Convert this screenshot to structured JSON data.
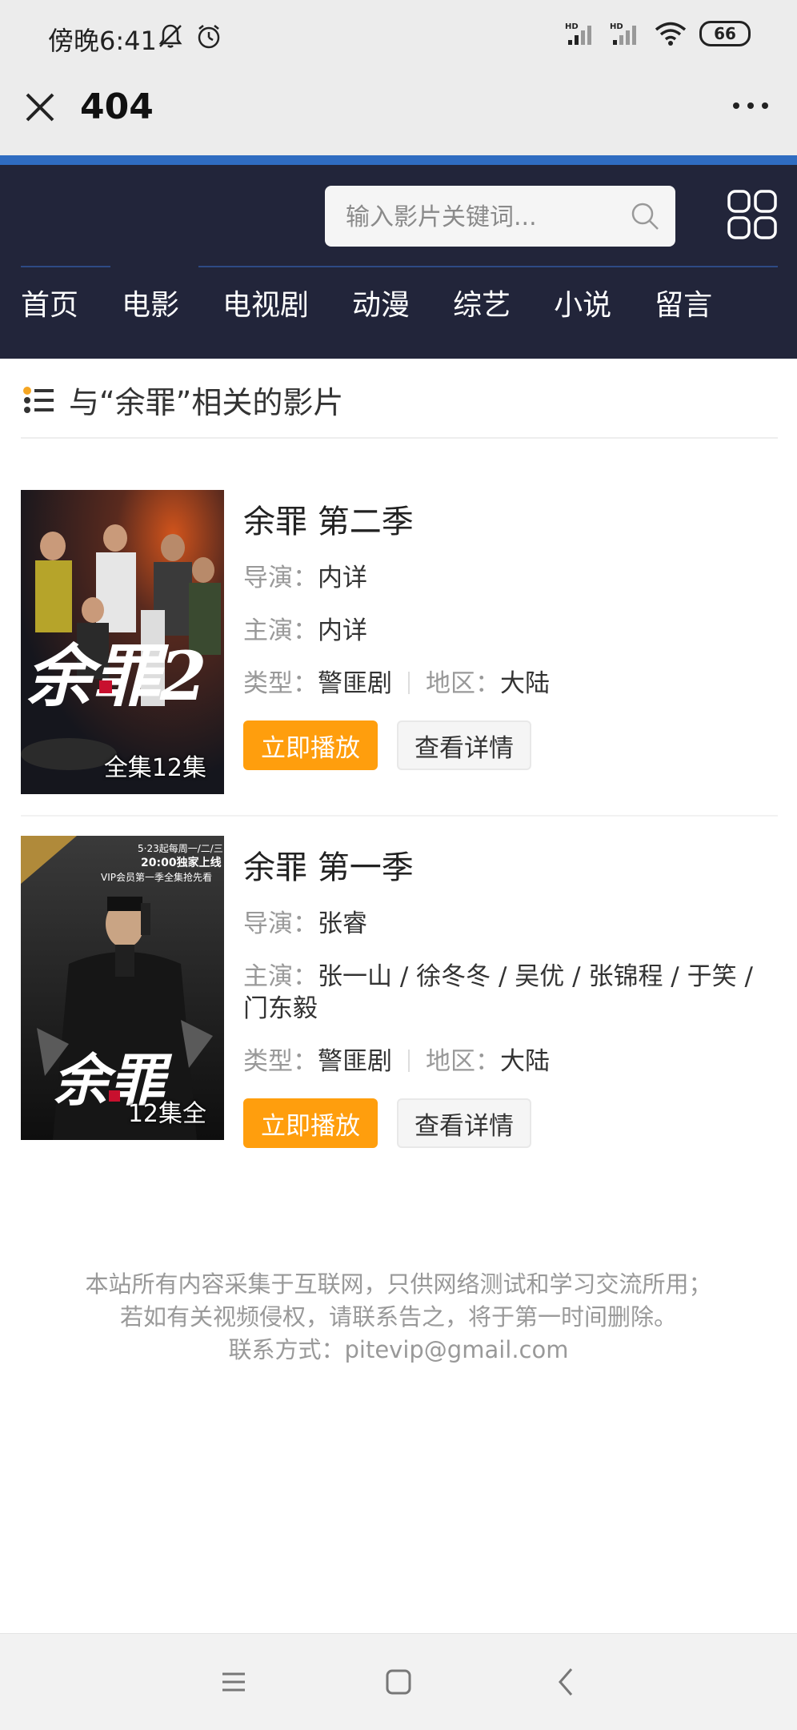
{
  "status_bar": {
    "time": "傍晚6:41",
    "network_label_1": "HD",
    "network_label_2": "HD",
    "battery": "66"
  },
  "title_bar": {
    "title": "404",
    "close_icon": "close-icon",
    "more_icon": "more-icon"
  },
  "header": {
    "accent_color": "#2f6cc1",
    "background_color": "#22253a",
    "search_placeholder": "输入影片关键词...",
    "nav": [
      "首页",
      "电影",
      "电视剧",
      "动漫",
      "综艺",
      "小说",
      "留言"
    ]
  },
  "section": {
    "title": "与“余罪”相关的影片"
  },
  "movies": [
    {
      "title": "余罪 第二季",
      "director_label": "导演：",
      "director": "内详",
      "actors_label": "主演：",
      "actors": "内详",
      "genre_label": "类型：",
      "genre": "警匪剧",
      "region_label": "地区：",
      "region": "大陆",
      "poster_caption": "全集12集",
      "poster_title": "余罪2",
      "play_label": "立即播放",
      "detail_label": "查看详情"
    },
    {
      "title": "余罪 第一季",
      "director_label": "导演：",
      "director": "张睿",
      "actors_label": "主演：",
      "actors": "张一山 / 徐冬冬 / 吴优 / 张锦程 / 于笑 / 门东毅",
      "genre_label": "类型：",
      "genre": "警匪剧",
      "region_label": "地区：",
      "region": "大陆",
      "poster_caption": "12集全",
      "poster_title": "余罪",
      "poster_promo_1": "5·23起每周一/二/三",
      "poster_promo_2": "20:00独家上线",
      "poster_promo_3": "VIP会员第一季全集抢先看",
      "play_label": "立即播放",
      "detail_label": "查看详情"
    }
  ],
  "footer": {
    "line1": "本站所有内容采集于互联网，只供网络测试和学习交流所用；",
    "line2": "若如有关视频侵权，请联系告之，将于第一时间删除。",
    "line3": "联系方式：pitevip@gmail.com"
  },
  "colors": {
    "play_button": "#ff9e0d"
  }
}
